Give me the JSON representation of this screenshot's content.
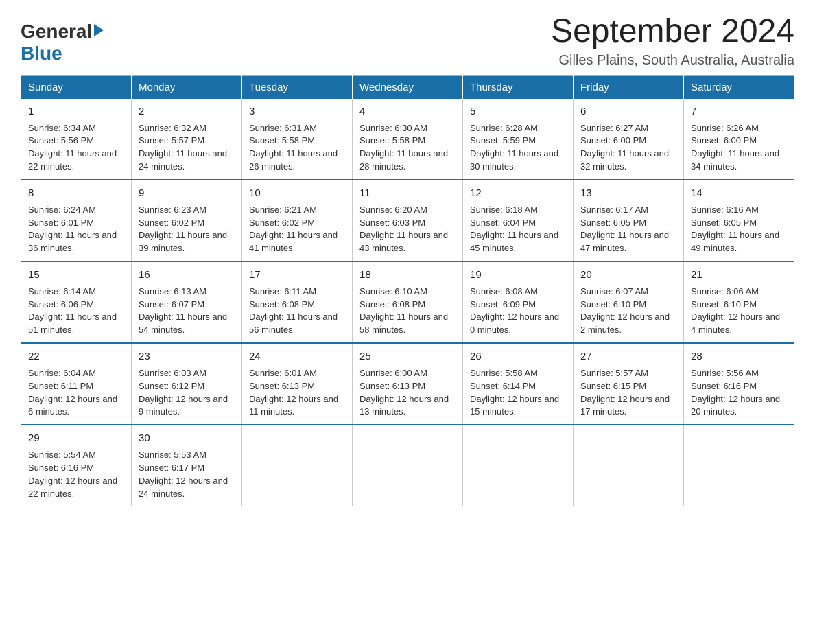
{
  "header": {
    "logo_general": "General",
    "logo_blue": "Blue",
    "month_year": "September 2024",
    "location": "Gilles Plains, South Australia, Australia"
  },
  "weekdays": [
    "Sunday",
    "Monday",
    "Tuesday",
    "Wednesday",
    "Thursday",
    "Friday",
    "Saturday"
  ],
  "weeks": [
    [
      {
        "day": "1",
        "sunrise": "Sunrise: 6:34 AM",
        "sunset": "Sunset: 5:56 PM",
        "daylight": "Daylight: 11 hours and 22 minutes."
      },
      {
        "day": "2",
        "sunrise": "Sunrise: 6:32 AM",
        "sunset": "Sunset: 5:57 PM",
        "daylight": "Daylight: 11 hours and 24 minutes."
      },
      {
        "day": "3",
        "sunrise": "Sunrise: 6:31 AM",
        "sunset": "Sunset: 5:58 PM",
        "daylight": "Daylight: 11 hours and 26 minutes."
      },
      {
        "day": "4",
        "sunrise": "Sunrise: 6:30 AM",
        "sunset": "Sunset: 5:58 PM",
        "daylight": "Daylight: 11 hours and 28 minutes."
      },
      {
        "day": "5",
        "sunrise": "Sunrise: 6:28 AM",
        "sunset": "Sunset: 5:59 PM",
        "daylight": "Daylight: 11 hours and 30 minutes."
      },
      {
        "day": "6",
        "sunrise": "Sunrise: 6:27 AM",
        "sunset": "Sunset: 6:00 PM",
        "daylight": "Daylight: 11 hours and 32 minutes."
      },
      {
        "day": "7",
        "sunrise": "Sunrise: 6:26 AM",
        "sunset": "Sunset: 6:00 PM",
        "daylight": "Daylight: 11 hours and 34 minutes."
      }
    ],
    [
      {
        "day": "8",
        "sunrise": "Sunrise: 6:24 AM",
        "sunset": "Sunset: 6:01 PM",
        "daylight": "Daylight: 11 hours and 36 minutes."
      },
      {
        "day": "9",
        "sunrise": "Sunrise: 6:23 AM",
        "sunset": "Sunset: 6:02 PM",
        "daylight": "Daylight: 11 hours and 39 minutes."
      },
      {
        "day": "10",
        "sunrise": "Sunrise: 6:21 AM",
        "sunset": "Sunset: 6:02 PM",
        "daylight": "Daylight: 11 hours and 41 minutes."
      },
      {
        "day": "11",
        "sunrise": "Sunrise: 6:20 AM",
        "sunset": "Sunset: 6:03 PM",
        "daylight": "Daylight: 11 hours and 43 minutes."
      },
      {
        "day": "12",
        "sunrise": "Sunrise: 6:18 AM",
        "sunset": "Sunset: 6:04 PM",
        "daylight": "Daylight: 11 hours and 45 minutes."
      },
      {
        "day": "13",
        "sunrise": "Sunrise: 6:17 AM",
        "sunset": "Sunset: 6:05 PM",
        "daylight": "Daylight: 11 hours and 47 minutes."
      },
      {
        "day": "14",
        "sunrise": "Sunrise: 6:16 AM",
        "sunset": "Sunset: 6:05 PM",
        "daylight": "Daylight: 11 hours and 49 minutes."
      }
    ],
    [
      {
        "day": "15",
        "sunrise": "Sunrise: 6:14 AM",
        "sunset": "Sunset: 6:06 PM",
        "daylight": "Daylight: 11 hours and 51 minutes."
      },
      {
        "day": "16",
        "sunrise": "Sunrise: 6:13 AM",
        "sunset": "Sunset: 6:07 PM",
        "daylight": "Daylight: 11 hours and 54 minutes."
      },
      {
        "day": "17",
        "sunrise": "Sunrise: 6:11 AM",
        "sunset": "Sunset: 6:08 PM",
        "daylight": "Daylight: 11 hours and 56 minutes."
      },
      {
        "day": "18",
        "sunrise": "Sunrise: 6:10 AM",
        "sunset": "Sunset: 6:08 PM",
        "daylight": "Daylight: 11 hours and 58 minutes."
      },
      {
        "day": "19",
        "sunrise": "Sunrise: 6:08 AM",
        "sunset": "Sunset: 6:09 PM",
        "daylight": "Daylight: 12 hours and 0 minutes."
      },
      {
        "day": "20",
        "sunrise": "Sunrise: 6:07 AM",
        "sunset": "Sunset: 6:10 PM",
        "daylight": "Daylight: 12 hours and 2 minutes."
      },
      {
        "day": "21",
        "sunrise": "Sunrise: 6:06 AM",
        "sunset": "Sunset: 6:10 PM",
        "daylight": "Daylight: 12 hours and 4 minutes."
      }
    ],
    [
      {
        "day": "22",
        "sunrise": "Sunrise: 6:04 AM",
        "sunset": "Sunset: 6:11 PM",
        "daylight": "Daylight: 12 hours and 6 minutes."
      },
      {
        "day": "23",
        "sunrise": "Sunrise: 6:03 AM",
        "sunset": "Sunset: 6:12 PM",
        "daylight": "Daylight: 12 hours and 9 minutes."
      },
      {
        "day": "24",
        "sunrise": "Sunrise: 6:01 AM",
        "sunset": "Sunset: 6:13 PM",
        "daylight": "Daylight: 12 hours and 11 minutes."
      },
      {
        "day": "25",
        "sunrise": "Sunrise: 6:00 AM",
        "sunset": "Sunset: 6:13 PM",
        "daylight": "Daylight: 12 hours and 13 minutes."
      },
      {
        "day": "26",
        "sunrise": "Sunrise: 5:58 AM",
        "sunset": "Sunset: 6:14 PM",
        "daylight": "Daylight: 12 hours and 15 minutes."
      },
      {
        "day": "27",
        "sunrise": "Sunrise: 5:57 AM",
        "sunset": "Sunset: 6:15 PM",
        "daylight": "Daylight: 12 hours and 17 minutes."
      },
      {
        "day": "28",
        "sunrise": "Sunrise: 5:56 AM",
        "sunset": "Sunset: 6:16 PM",
        "daylight": "Daylight: 12 hours and 20 minutes."
      }
    ],
    [
      {
        "day": "29",
        "sunrise": "Sunrise: 5:54 AM",
        "sunset": "Sunset: 6:16 PM",
        "daylight": "Daylight: 12 hours and 22 minutes."
      },
      {
        "day": "30",
        "sunrise": "Sunrise: 5:53 AM",
        "sunset": "Sunset: 6:17 PM",
        "daylight": "Daylight: 12 hours and 24 minutes."
      },
      null,
      null,
      null,
      null,
      null
    ]
  ]
}
